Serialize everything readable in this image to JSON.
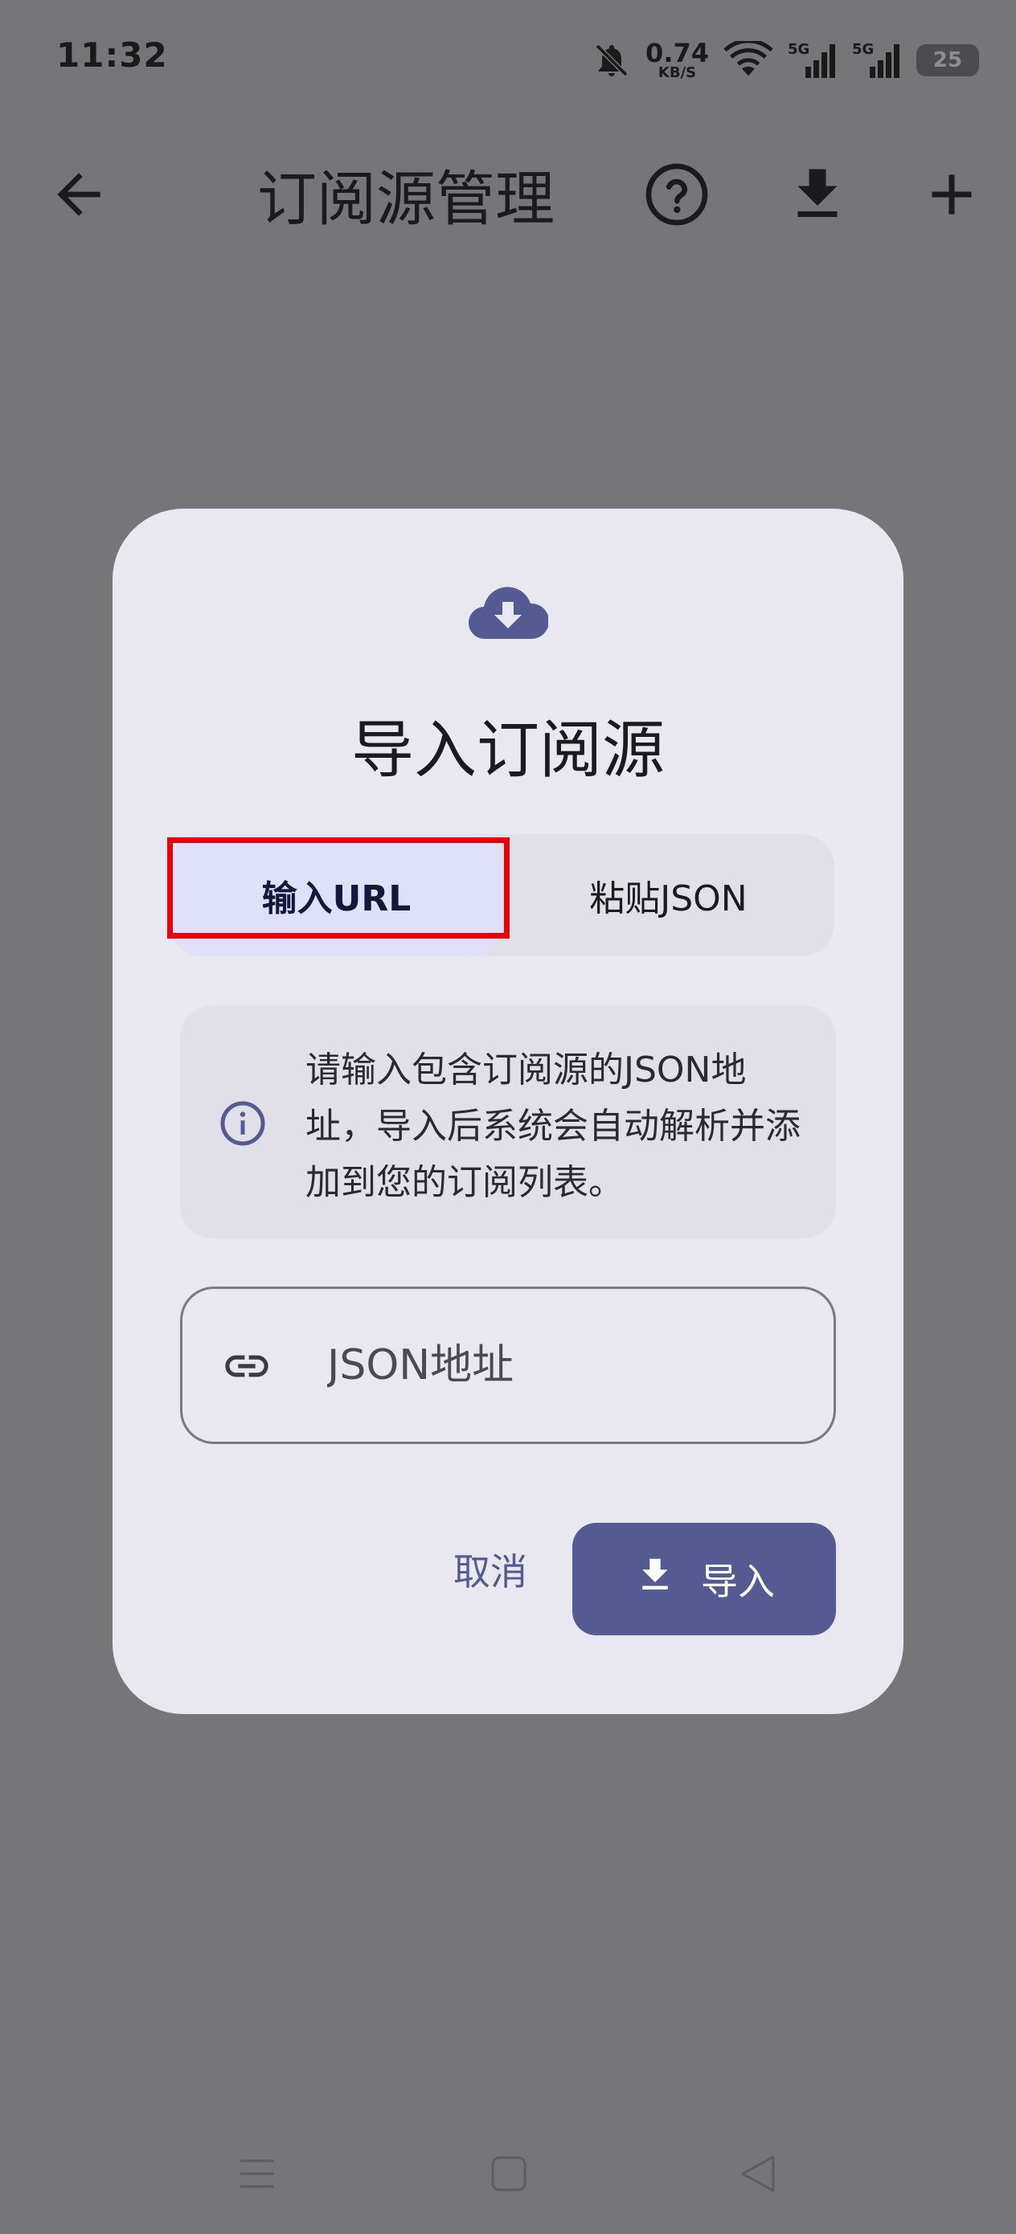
{
  "status_bar": {
    "time": "11:32",
    "net_speed_value": "0.74",
    "net_speed_unit": "KB/S",
    "signal_1": "5G",
    "signal_2": "5G",
    "battery": "25"
  },
  "app_bar": {
    "title": "订阅源管理",
    "icons": [
      "arrow-back-icon",
      "help-icon",
      "download-icon",
      "add-icon"
    ]
  },
  "dialog": {
    "title": "导入订阅源",
    "tabs": {
      "url": "输入URL",
      "json": "粘贴JSON",
      "selected": "url"
    },
    "info_text": "请输入包含订阅源的JSON地址，导入后系统会自动解析并添加到您的订阅列表。",
    "url_field": {
      "placeholder": "JSON地址",
      "value": ""
    },
    "cancel_label": "取消",
    "import_label": "导入"
  },
  "colors": {
    "scrim": "#767678",
    "dialog_bg": "#e9e7ef",
    "primary": "#535b92",
    "selected_tab": "#dfe0fa",
    "highlight_border": "#e8000b"
  }
}
